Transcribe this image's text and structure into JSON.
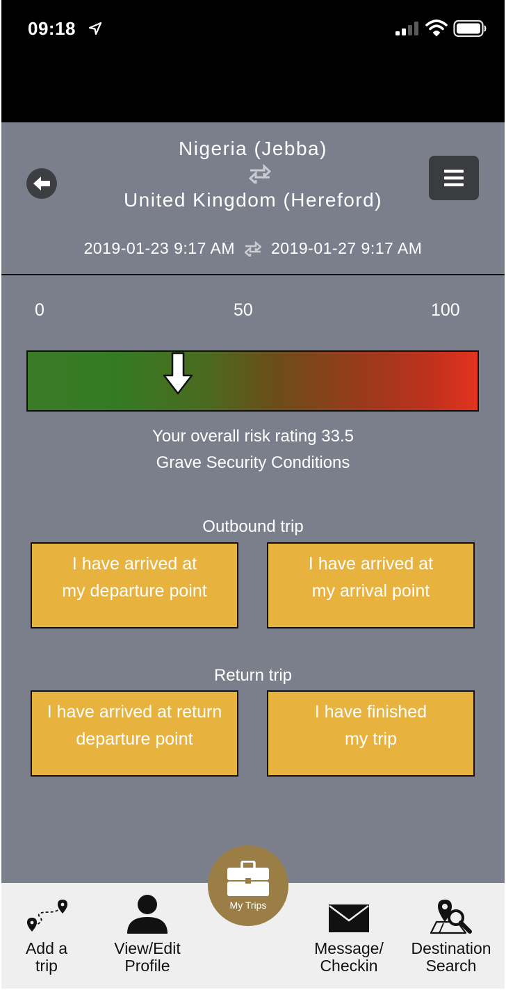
{
  "status_bar": {
    "time": "09:18"
  },
  "header": {
    "origin": "Nigeria (Jebba)",
    "destination": "United Kingdom (Hereford)",
    "depart_date": "2019-01-23 9:17 AM",
    "return_date": "2019-01-27 9:17 AM"
  },
  "risk": {
    "scale_min": "0",
    "scale_mid": "50",
    "scale_max": "100",
    "rating_text": "Your overall risk rating 33.5",
    "rating_value": 33.5,
    "level_text": "Grave Security Conditions"
  },
  "outbound": {
    "title": "Outbound trip",
    "departure_line1": "I have arrived at",
    "departure_line2": "my departure point",
    "arrival_line1": "I have arrived at",
    "arrival_line2": "my arrival point"
  },
  "return_trip": {
    "title": "Return trip",
    "departure_line1": "I have arrived at return",
    "departure_line2": "departure point",
    "finished_line1": "I have finished",
    "finished_line2": "my trip"
  },
  "tabs": {
    "add_trip_line1": "Add a",
    "add_trip_line2": "trip",
    "profile_line1": "View/Edit",
    "profile_line2": "Profile",
    "my_trips": "My Trips",
    "message_line1": "Message/",
    "message_line2": "Checkin",
    "search_line1": "Destination",
    "search_line2": "Search"
  },
  "colors": {
    "content_bg": "#7b7f8c",
    "button_bg": "#e8b23f",
    "my_trips_bg": "#9a7e45",
    "tab_bar_bg": "#efefef"
  }
}
